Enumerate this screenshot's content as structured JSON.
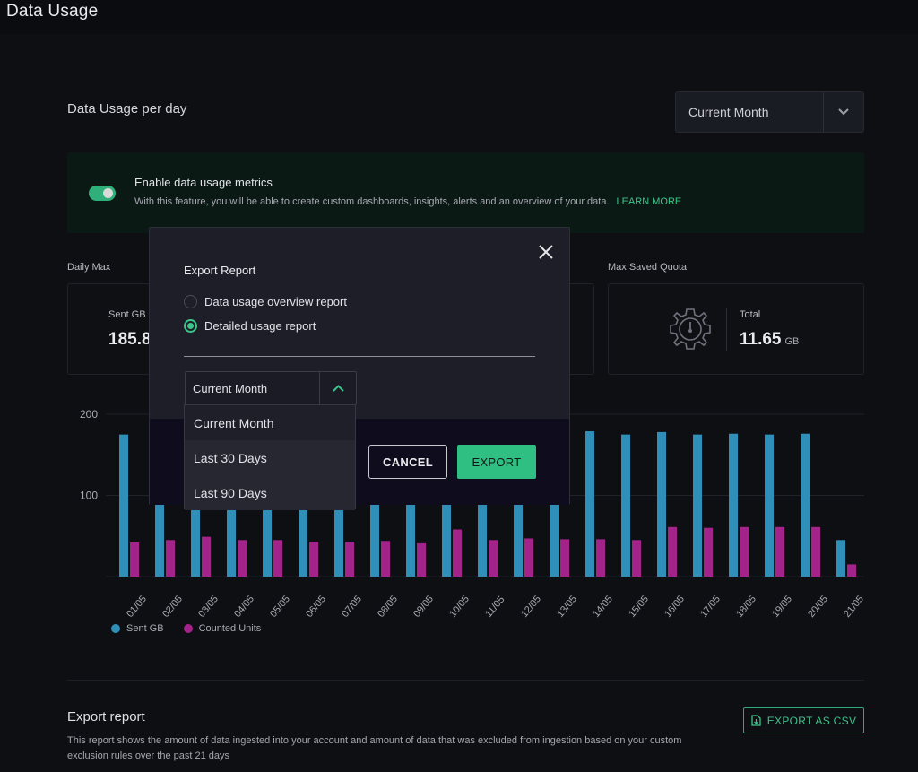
{
  "page": {
    "title": "Data Usage"
  },
  "usage_section": {
    "title": "Data Usage per day",
    "range_select": {
      "value": "Current Month"
    }
  },
  "banner": {
    "title": "Enable data usage metrics",
    "text": "With this feature, you will be able to create custom dashboards, insights, alerts and an overview of your data.",
    "link": "LEARN MORE",
    "toggle_on": true
  },
  "stats": {
    "daily_max": {
      "label": "Daily Max",
      "sub": "Sent GB",
      "value": "185.8"
    },
    "max_saved_quota": {
      "label": "Max Saved Quota",
      "sub": "Total",
      "value": "11.65",
      "unit": "GB",
      "icon": "gauge-gear-icon"
    }
  },
  "chart_data": {
    "type": "bar",
    "categories": [
      "01/05",
      "02/05",
      "03/05",
      "04/05",
      "05/05",
      "06/05",
      "07/05",
      "08/05",
      "09/05",
      "10/05",
      "11/05",
      "12/05",
      "13/05",
      "14/05",
      "15/05",
      "16/05",
      "17/05",
      "18/05",
      "19/05",
      "20/05",
      "21/05"
    ],
    "series": [
      {
        "name": "Sent GB",
        "color": "#2f8fb8",
        "values": [
          175,
          176,
          175,
          175,
          176,
          175,
          176,
          175,
          176,
          175,
          176,
          175,
          176,
          179,
          175,
          178,
          175,
          176,
          175,
          176,
          45
        ]
      },
      {
        "name": "Counted Units",
        "color": "#a3238a",
        "values": [
          42,
          45,
          49,
          45,
          45,
          43,
          43,
          44,
          41,
          58,
          45,
          47,
          46,
          46,
          45,
          61,
          60,
          61,
          61,
          61,
          15
        ]
      }
    ],
    "yticks": [
      100,
      200
    ],
    "ylim": [
      0,
      200
    ],
    "xlabel": "",
    "ylabel": "",
    "legend": "bottom-left",
    "grid": true
  },
  "export_section": {
    "title": "Export report",
    "description": "This report shows the amount of data ingested into your account and amount of data that was excluded from ingestion based on your custom exclusion rules over the past 21 days",
    "csv_button": "EXPORT AS CSV"
  },
  "modal": {
    "title": "Export Report",
    "options": [
      {
        "label": "Data usage overview report",
        "selected": false
      },
      {
        "label": "Detailed usage report",
        "selected": true
      }
    ],
    "select_value": "Current Month",
    "dropdown_options": [
      "Current Month",
      "Last 30 Days",
      "Last 90 Days"
    ],
    "cancel_label": "CANCEL",
    "export_label": "EXPORT"
  },
  "colors": {
    "accent": "#3cc48a",
    "sent": "#2f8fb8",
    "units": "#a3238a"
  }
}
